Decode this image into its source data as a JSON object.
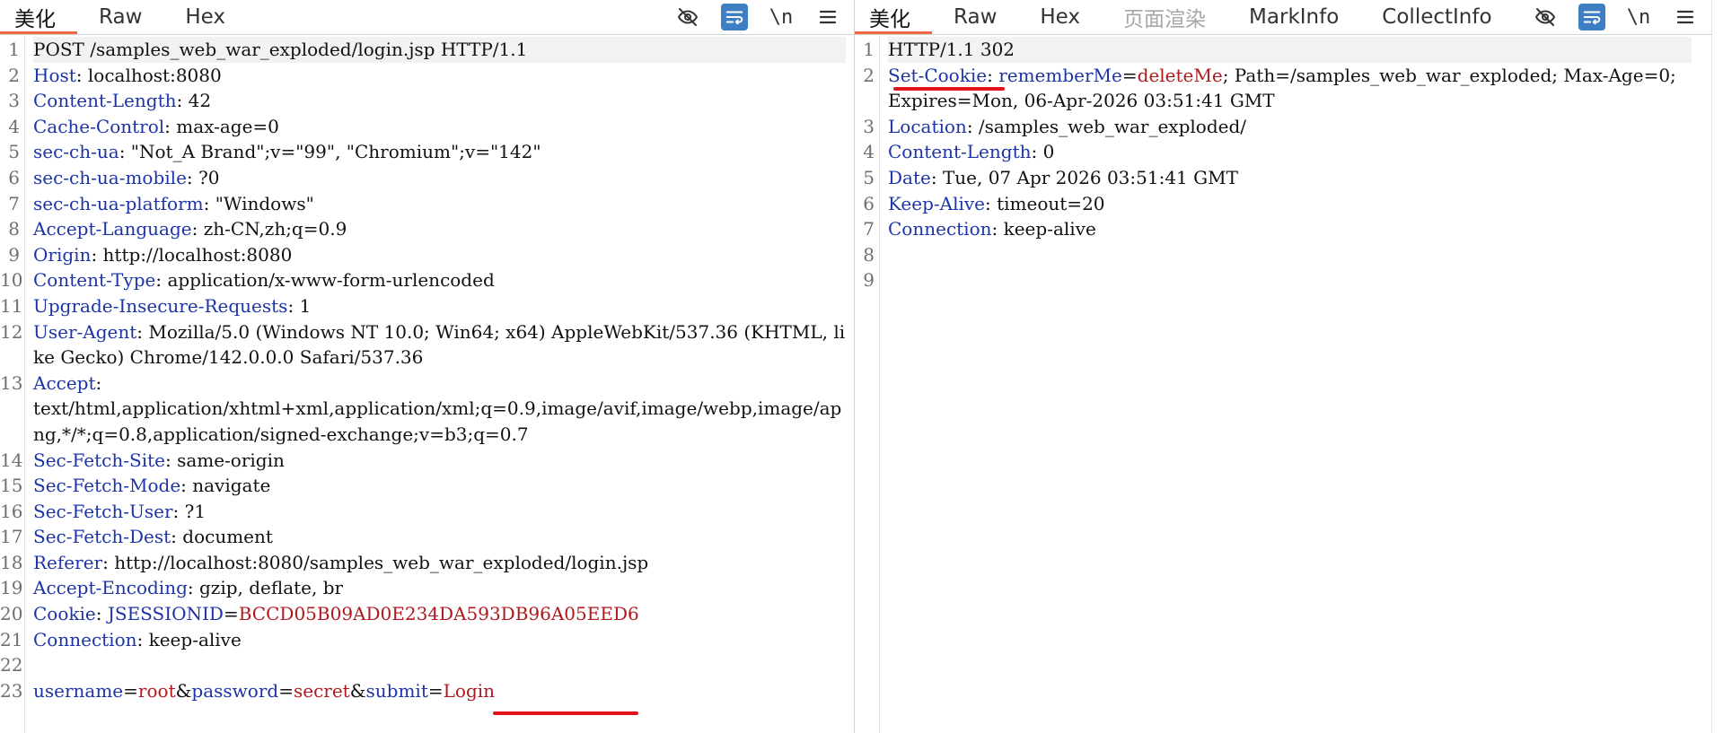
{
  "left": {
    "tabs": [
      {
        "label": "美化",
        "active": true
      },
      {
        "label": "Raw"
      },
      {
        "label": "Hex"
      }
    ],
    "toolbar": {
      "toggle_icon": "eye-off-icon",
      "wrap_icon": "wrap-icon",
      "newline_label": "\\n",
      "menu_icon": "menu-icon"
    },
    "lines": [
      {
        "n": "1",
        "parts": [
          {
            "t": "POST /samples_web_war_exploded/login.jsp HTTP/1.1"
          }
        ]
      },
      {
        "n": "2",
        "parts": [
          {
            "t": "Host",
            "c": "hk"
          },
          {
            "t": ": localhost:8080"
          }
        ]
      },
      {
        "n": "3",
        "parts": [
          {
            "t": "Content-Length",
            "c": "hk"
          },
          {
            "t": ": 42"
          }
        ]
      },
      {
        "n": "4",
        "parts": [
          {
            "t": "Cache-Control",
            "c": "hk"
          },
          {
            "t": ": max-age=0"
          }
        ]
      },
      {
        "n": "5",
        "parts": [
          {
            "t": "sec-ch-ua",
            "c": "hk"
          },
          {
            "t": ": \"Not_A Brand\";v=\"99\", \"Chromium\";v=\"142\""
          }
        ]
      },
      {
        "n": "6",
        "parts": [
          {
            "t": "sec-ch-ua-mobile",
            "c": "hk"
          },
          {
            "t": ": ?0"
          }
        ]
      },
      {
        "n": "7",
        "parts": [
          {
            "t": "sec-ch-ua-platform",
            "c": "hk"
          },
          {
            "t": ": \"Windows\""
          }
        ]
      },
      {
        "n": "8",
        "parts": [
          {
            "t": "Accept-Language",
            "c": "hk"
          },
          {
            "t": ": zh-CN,zh;q=0.9"
          }
        ]
      },
      {
        "n": "9",
        "parts": [
          {
            "t": "Origin",
            "c": "hk"
          },
          {
            "t": ": http://localhost:8080"
          }
        ]
      },
      {
        "n": "10",
        "parts": [
          {
            "t": "Content-Type",
            "c": "hk"
          },
          {
            "t": ": application/x-www-form-urlencoded"
          }
        ]
      },
      {
        "n": "11",
        "parts": [
          {
            "t": "Upgrade-Insecure-Requests",
            "c": "hk"
          },
          {
            "t": ": 1"
          }
        ]
      },
      {
        "n": "12",
        "parts": [
          {
            "t": "User-Agent",
            "c": "hk"
          },
          {
            "t": ": Mozilla/5.0 (Windows NT 10.0; Win64; x64) AppleWebKit/537.36 (KHTML, like Gecko) Chrome/142.0.0.0 Safari/537.36"
          }
        ]
      },
      {
        "n": "13",
        "parts": [
          {
            "t": "Accept",
            "c": "hk"
          },
          {
            "t": ":\ntext/html,application/xhtml+xml,application/xml;q=0.9,image/avif,image/webp,image/apng,*/*;q=0.8,application/signed-exchange;v=b3;q=0.7"
          }
        ]
      },
      {
        "n": "14",
        "parts": [
          {
            "t": "Sec-Fetch-Site",
            "c": "hk"
          },
          {
            "t": ": same-origin"
          }
        ]
      },
      {
        "n": "15",
        "parts": [
          {
            "t": "Sec-Fetch-Mode",
            "c": "hk"
          },
          {
            "t": ": navigate"
          }
        ]
      },
      {
        "n": "16",
        "parts": [
          {
            "t": "Sec-Fetch-User",
            "c": "hk"
          },
          {
            "t": ": ?1"
          }
        ]
      },
      {
        "n": "17",
        "parts": [
          {
            "t": "Sec-Fetch-Dest",
            "c": "hk"
          },
          {
            "t": ": document"
          }
        ]
      },
      {
        "n": "18",
        "parts": [
          {
            "t": "Referer",
            "c": "hk"
          },
          {
            "t": ": http://localhost:8080/samples_web_war_exploded/login.jsp"
          }
        ]
      },
      {
        "n": "19",
        "parts": [
          {
            "t": "Accept-Encoding",
            "c": "hk"
          },
          {
            "t": ": gzip, deflate, br"
          }
        ]
      },
      {
        "n": "20",
        "parts": [
          {
            "t": "Cookie",
            "c": "hk"
          },
          {
            "t": ": "
          },
          {
            "t": "JSESSIONID",
            "c": "ck"
          },
          {
            "t": "="
          },
          {
            "t": "BCCD05B09AD0E234DA593DB96A05EED6",
            "c": "cv"
          }
        ]
      },
      {
        "n": "21",
        "parts": [
          {
            "t": "Connection",
            "c": "hk"
          },
          {
            "t": ": keep-alive"
          }
        ]
      },
      {
        "n": "22",
        "parts": [
          {
            "t": ""
          }
        ]
      },
      {
        "n": "23",
        "parts": [
          {
            "t": "username",
            "c": "ck"
          },
          {
            "t": "="
          },
          {
            "t": "root",
            "c": "cv"
          },
          {
            "t": "&"
          },
          {
            "t": "password",
            "c": "ck"
          },
          {
            "t": "="
          },
          {
            "t": "secret",
            "c": "cv"
          },
          {
            "t": "&"
          },
          {
            "t": "submit",
            "c": "ck"
          },
          {
            "t": "="
          },
          {
            "t": "Login",
            "c": "cv"
          }
        ]
      }
    ]
  },
  "right": {
    "tabs": [
      {
        "label": "美化",
        "active": true
      },
      {
        "label": "Raw"
      },
      {
        "label": "Hex"
      },
      {
        "label": "页面渲染",
        "disabled": true
      },
      {
        "label": "MarkInfo"
      },
      {
        "label": "CollectInfo"
      }
    ],
    "toolbar": {
      "toggle_icon": "eye-off-icon",
      "wrap_icon": "wrap-icon",
      "newline_label": "\\n",
      "menu_icon": "menu-icon"
    },
    "lines": [
      {
        "n": "1",
        "parts": [
          {
            "t": "HTTP/1.1 302"
          }
        ]
      },
      {
        "n": "2",
        "parts": [
          {
            "t": "Set-Cookie",
            "c": "hk"
          },
          {
            "t": ": "
          },
          {
            "t": "rememberMe",
            "c": "ck"
          },
          {
            "t": "="
          },
          {
            "t": "deleteMe",
            "c": "cv"
          },
          {
            "t": "; Path=/samples_web_war_exploded; Max-Age=0; Expires=Mon, 06-Apr-2026 03:51:41 GMT"
          }
        ]
      },
      {
        "n": "3",
        "parts": [
          {
            "t": "Location",
            "c": "hk"
          },
          {
            "t": ": /samples_web_war_exploded/"
          }
        ]
      },
      {
        "n": "4",
        "parts": [
          {
            "t": "Content-Length",
            "c": "hk"
          },
          {
            "t": ": 0"
          }
        ]
      },
      {
        "n": "5",
        "parts": [
          {
            "t": "Date",
            "c": "hk"
          },
          {
            "t": ": Tue, 07 Apr 2026 03:51:41 GMT"
          }
        ]
      },
      {
        "n": "6",
        "parts": [
          {
            "t": "Keep-Alive",
            "c": "hk"
          },
          {
            "t": ": timeout=20"
          }
        ]
      },
      {
        "n": "7",
        "parts": [
          {
            "t": "Connection",
            "c": "hk"
          },
          {
            "t": ": keep-alive"
          }
        ]
      },
      {
        "n": "8",
        "parts": [
          {
            "t": ""
          }
        ]
      },
      {
        "n": "9",
        "parts": [
          {
            "t": ""
          }
        ]
      }
    ]
  },
  "colors": {
    "accent_tab": "#f0663e",
    "header_key": "#1c34a8",
    "value_red": "#b0181d",
    "annotation": "#e0141a",
    "tool_active": "#3d7fc2"
  }
}
